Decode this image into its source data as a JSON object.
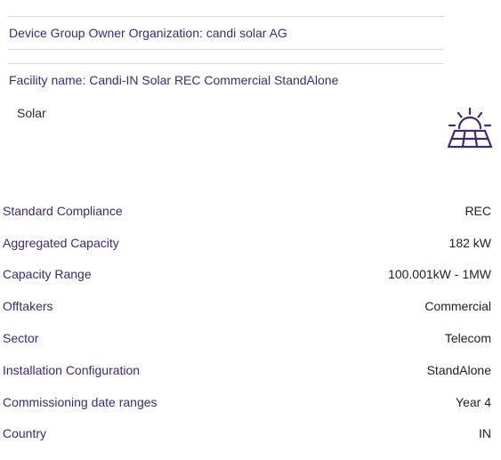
{
  "header": {
    "owner_organization": "Device Group Owner Organization: candi solar AG",
    "facility_name": "Facility name: Candi-IN Solar REC Commercial StandAlone"
  },
  "device": {
    "type_label": "Solar",
    "icon": "solar-panel-sun-icon",
    "icon_color": "#3c2a72"
  },
  "specs": [
    {
      "label": "Standard Compliance",
      "value": "REC"
    },
    {
      "label": "Aggregated Capacity",
      "value": "182 kW"
    },
    {
      "label": "Capacity Range",
      "value": "100.001kW - 1MW"
    },
    {
      "label": "Offtakers",
      "value": "Commercial"
    },
    {
      "label": "Sector",
      "value": "Telecom"
    },
    {
      "label": "Installation Configuration",
      "value": "StandAlone"
    },
    {
      "label": "Commissioning date ranges",
      "value": "Year 4"
    },
    {
      "label": "Country",
      "value": "IN"
    }
  ],
  "colors": {
    "label": "#3c2a72",
    "value": "#1f1f1f",
    "divider": "#d9d9d9"
  }
}
